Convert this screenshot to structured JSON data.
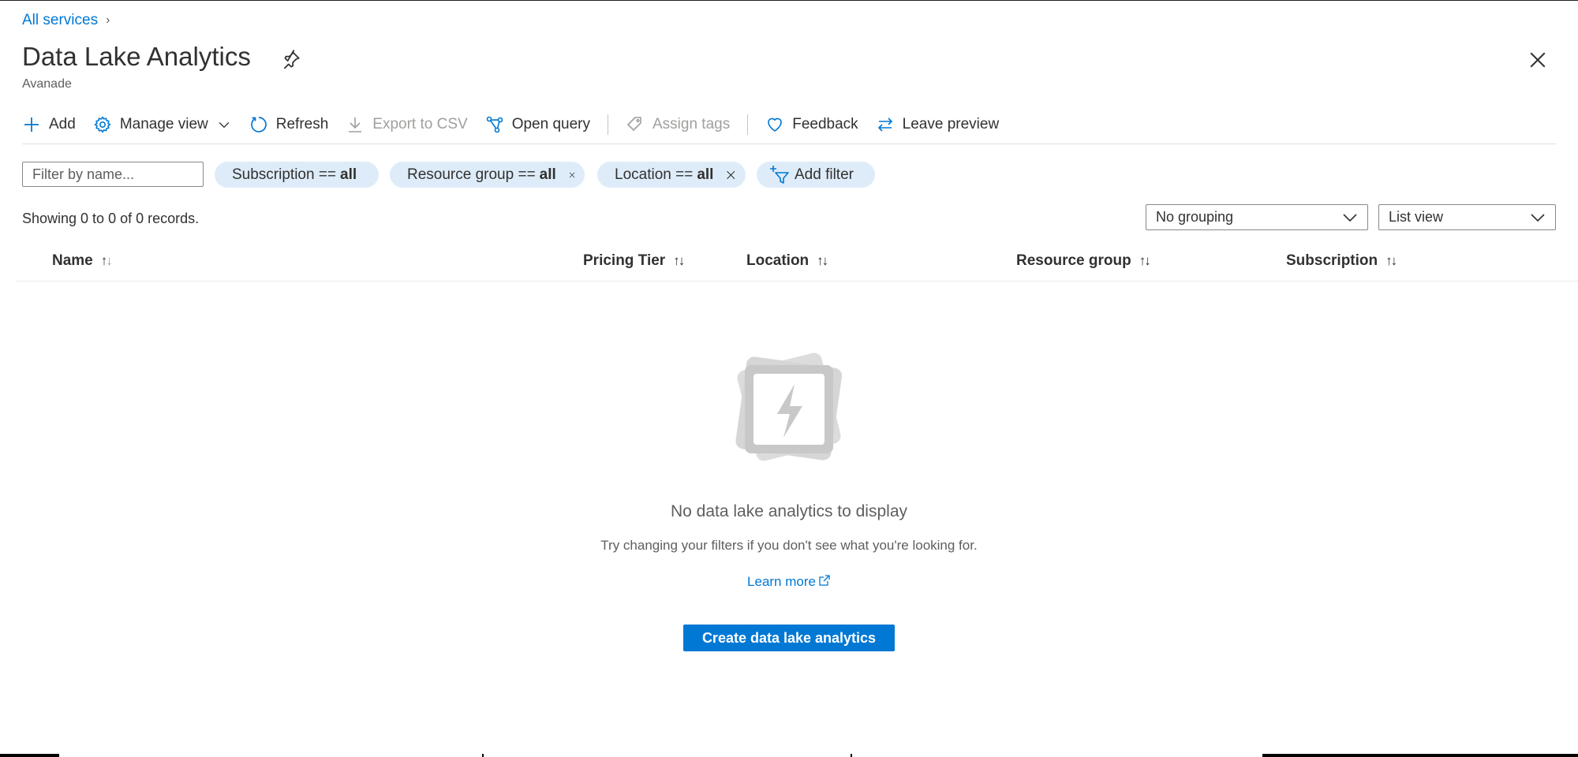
{
  "breadcrumb": {
    "root": "All services",
    "chevron": "›"
  },
  "header": {
    "title": "Data Lake Analytics",
    "subtitle": "Avanade"
  },
  "toolbar": {
    "add": "Add",
    "manage_view": "Manage view",
    "refresh": "Refresh",
    "export_csv": "Export to CSV",
    "open_query": "Open query",
    "assign_tags": "Assign tags",
    "feedback": "Feedback",
    "leave_preview": "Leave preview"
  },
  "filters": {
    "placeholder": "Filter by name...",
    "subscription": {
      "label": "Subscription ==",
      "value": "all"
    },
    "resource_group": {
      "label": "Resource group ==",
      "value": "all"
    },
    "location": {
      "label": "Location ==",
      "value": "all"
    },
    "add_filter": "Add filter"
  },
  "records": "Showing 0 to 0 of 0 records.",
  "grouping": {
    "selected": "No grouping"
  },
  "view": {
    "selected": "List view"
  },
  "table": {
    "columns": [
      "Name",
      "Pricing Tier",
      "Location",
      "Resource group",
      "Subscription"
    ],
    "rows": []
  },
  "empty_state": {
    "title": "No data lake analytics to display",
    "subtitle": "Try changing your filters if you don't see what you're looking for.",
    "learn_more": "Learn more",
    "create_button": "Create data lake analytics"
  },
  "colors": {
    "accent": "#0078d4",
    "pill_bg": "#deecf9",
    "text": "#323130",
    "muted": "#605e5c"
  },
  "icons": [
    "chevron-right-icon",
    "pin-icon",
    "close-icon",
    "plus-icon",
    "gear-icon",
    "chevron-down-icon",
    "refresh-icon",
    "download-icon",
    "query-icon",
    "tag-icon",
    "heart-icon",
    "swap-icon",
    "filter-add-icon",
    "sort-icon",
    "lightning-icon",
    "external-link-icon"
  ]
}
